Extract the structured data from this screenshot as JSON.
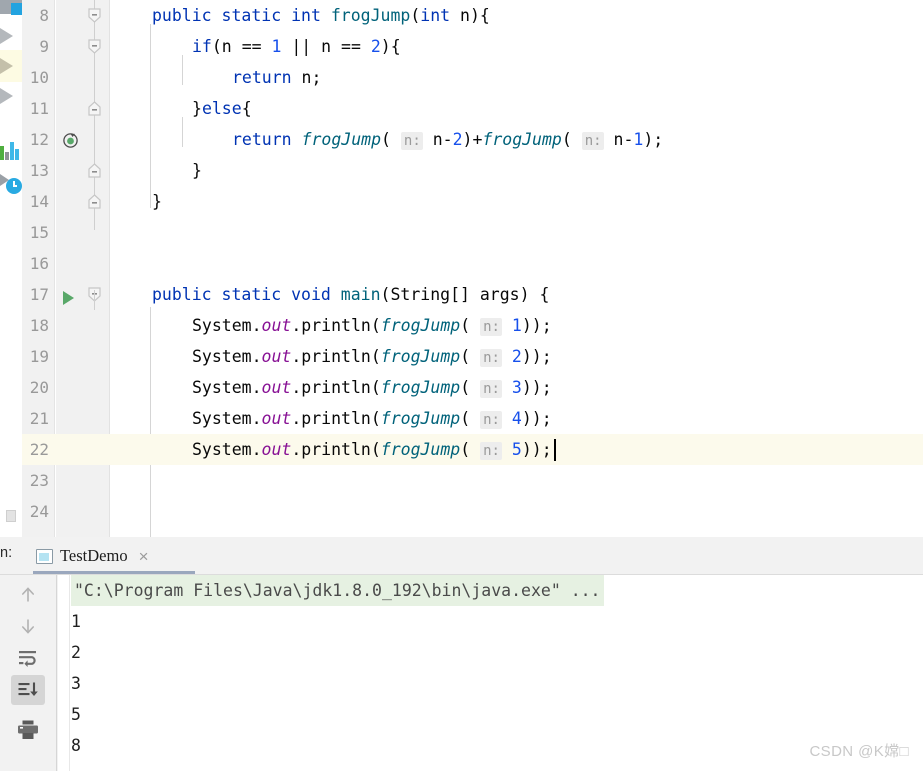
{
  "editor": {
    "font_size_px": 16.5,
    "current_line": 22,
    "first_visible_line": 8,
    "lines": [
      {
        "num": "8",
        "indent": 4,
        "tokens": [
          {
            "t": "public ",
            "c": "kw"
          },
          {
            "t": "static ",
            "c": "kw"
          },
          {
            "t": "int ",
            "c": "kw"
          },
          {
            "t": "frogJump",
            "c": "mth"
          },
          {
            "t": "(",
            "c": "brc"
          },
          {
            "t": "int",
            "c": "kw"
          },
          {
            "t": " n)",
            "c": "pln"
          },
          {
            "t": "{",
            "c": "brc"
          }
        ]
      },
      {
        "num": "9",
        "indent": 8,
        "tokens": [
          {
            "t": "if",
            "c": "kw"
          },
          {
            "t": "(n ",
            "c": "pln"
          },
          {
            "t": "== ",
            "c": "pln"
          },
          {
            "t": "1",
            "c": "num"
          },
          {
            "t": " || n ",
            "c": "pln"
          },
          {
            "t": "== ",
            "c": "pln"
          },
          {
            "t": "2",
            "c": "num"
          },
          {
            "t": "){",
            "c": "brc"
          }
        ]
      },
      {
        "num": "10",
        "indent": 12,
        "tokens": [
          {
            "t": "return ",
            "c": "kw"
          },
          {
            "t": "n;",
            "c": "pln"
          }
        ]
      },
      {
        "num": "11",
        "indent": 8,
        "tokens": [
          {
            "t": "}",
            "c": "brc"
          },
          {
            "t": "else",
            "c": "kw"
          },
          {
            "t": "{",
            "c": "brc"
          }
        ]
      },
      {
        "num": "12",
        "indent": 12,
        "tokens": [
          {
            "t": "return ",
            "c": "kw"
          },
          {
            "t": "frogJump",
            "c": "mthi"
          },
          {
            "t": "( ",
            "c": "brc"
          },
          {
            "t": "n:",
            "c": "hint"
          },
          {
            "t": " n-",
            "c": "pln"
          },
          {
            "t": "2",
            "c": "num"
          },
          {
            "t": ")+",
            "c": "pln"
          },
          {
            "t": "frogJump",
            "c": "mthi"
          },
          {
            "t": "( ",
            "c": "brc"
          },
          {
            "t": "n:",
            "c": "hint"
          },
          {
            "t": " n-",
            "c": "pln"
          },
          {
            "t": "1",
            "c": "num"
          },
          {
            "t": ");",
            "c": "pln"
          }
        ]
      },
      {
        "num": "13",
        "indent": 8,
        "tokens": [
          {
            "t": "}",
            "c": "brc"
          }
        ]
      },
      {
        "num": "14",
        "indent": 4,
        "tokens": [
          {
            "t": "}",
            "c": "brc"
          }
        ]
      },
      {
        "num": "15",
        "indent": 0,
        "tokens": []
      },
      {
        "num": "16",
        "indent": 0,
        "tokens": []
      },
      {
        "num": "17",
        "indent": 4,
        "tokens": [
          {
            "t": "public ",
            "c": "kw"
          },
          {
            "t": "static ",
            "c": "kw"
          },
          {
            "t": "void ",
            "c": "kw"
          },
          {
            "t": "main",
            "c": "mth"
          },
          {
            "t": "(",
            "c": "brc"
          },
          {
            "t": "String",
            "c": "pln"
          },
          {
            "t": "[] args) ",
            "c": "pln"
          },
          {
            "t": "{",
            "c": "brc"
          }
        ]
      },
      {
        "num": "18",
        "indent": 8,
        "tokens": [
          {
            "t": "System.",
            "c": "pln"
          },
          {
            "t": "out",
            "c": "fld"
          },
          {
            "t": ".println(",
            "c": "pln"
          },
          {
            "t": "frogJump",
            "c": "mthi"
          },
          {
            "t": "( ",
            "c": "brc"
          },
          {
            "t": "n:",
            "c": "hint"
          },
          {
            "t": " ",
            "c": "pln"
          },
          {
            "t": "1",
            "c": "num"
          },
          {
            "t": "));",
            "c": "pln"
          }
        ]
      },
      {
        "num": "19",
        "indent": 8,
        "tokens": [
          {
            "t": "System.",
            "c": "pln"
          },
          {
            "t": "out",
            "c": "fld"
          },
          {
            "t": ".println(",
            "c": "pln"
          },
          {
            "t": "frogJump",
            "c": "mthi"
          },
          {
            "t": "( ",
            "c": "brc"
          },
          {
            "t": "n:",
            "c": "hint"
          },
          {
            "t": " ",
            "c": "pln"
          },
          {
            "t": "2",
            "c": "num"
          },
          {
            "t": "));",
            "c": "pln"
          }
        ]
      },
      {
        "num": "20",
        "indent": 8,
        "tokens": [
          {
            "t": "System.",
            "c": "pln"
          },
          {
            "t": "out",
            "c": "fld"
          },
          {
            "t": ".println(",
            "c": "pln"
          },
          {
            "t": "frogJump",
            "c": "mthi"
          },
          {
            "t": "( ",
            "c": "brc"
          },
          {
            "t": "n:",
            "c": "hint"
          },
          {
            "t": " ",
            "c": "pln"
          },
          {
            "t": "3",
            "c": "num"
          },
          {
            "t": "));",
            "c": "pln"
          }
        ]
      },
      {
        "num": "21",
        "indent": 8,
        "tokens": [
          {
            "t": "System.",
            "c": "pln"
          },
          {
            "t": "out",
            "c": "fld"
          },
          {
            "t": ".println(",
            "c": "pln"
          },
          {
            "t": "frogJump",
            "c": "mthi"
          },
          {
            "t": "( ",
            "c": "brc"
          },
          {
            "t": "n:",
            "c": "hint"
          },
          {
            "t": " ",
            "c": "pln"
          },
          {
            "t": "4",
            "c": "num"
          },
          {
            "t": "));",
            "c": "pln"
          }
        ]
      },
      {
        "num": "22",
        "indent": 8,
        "current": true,
        "caret": true,
        "tokens": [
          {
            "t": "System.",
            "c": "pln"
          },
          {
            "t": "out",
            "c": "fld"
          },
          {
            "t": ".println(",
            "c": "pln"
          },
          {
            "t": "frogJump",
            "c": "mthi"
          },
          {
            "t": "( ",
            "c": "brc"
          },
          {
            "t": "n:",
            "c": "hint"
          },
          {
            "t": " ",
            "c": "pln"
          },
          {
            "t": "5",
            "c": "num"
          },
          {
            "t": "));",
            "c": "pln"
          }
        ]
      },
      {
        "num": "23",
        "indent": 0,
        "tokens": []
      },
      {
        "num": "24",
        "indent": 0,
        "tokens": []
      }
    ],
    "gutter_icons": [
      {
        "line": "12",
        "kind": "recursive-method-icon"
      },
      {
        "line": "17",
        "kind": "run-method-icon"
      }
    ],
    "fold_markers": [
      "8",
      "9",
      "11",
      "13",
      "14",
      "17"
    ]
  },
  "run_panel": {
    "label": "n:",
    "tab": {
      "title": "TestDemo",
      "icon": "run-configuration-icon",
      "close": "×"
    },
    "toolbar": [
      {
        "name": "up-arrow-icon",
        "selected": false
      },
      {
        "name": "down-arrow-icon",
        "selected": false
      },
      {
        "name": "soft-wrap-icon",
        "selected": false
      },
      {
        "name": "scroll-to-end-icon",
        "selected": true
      },
      {
        "name": "print-icon",
        "selected": false
      }
    ],
    "console": {
      "command": "\"C:\\Program Files\\Java\\jdk1.8.0_192\\bin\\java.exe\" ...",
      "output": [
        "1",
        "2",
        "3",
        "5",
        "8"
      ]
    }
  },
  "tool_strip": {
    "icons": [
      "run-icon",
      "debug-icon",
      "stop-icon",
      "profiler-chart-icon",
      "run-with-coverage-clock-icon"
    ]
  },
  "watermark": {
    "text": "CSDN @K嫦□"
  },
  "colors": {
    "keyword": "#0033b3",
    "method": "#00627a",
    "number": "#1750eb",
    "static_field": "#871094",
    "plain": "#080808",
    "hint_bg": "#ededed",
    "hint_fg": "#9a9a9a",
    "gutter_bg": "#f1f1f1",
    "line_number": "#999999",
    "current_line_bg": "#fcfaec",
    "console_cmd_bg": "#e6f1e2",
    "panel_bg": "#f2f2f2",
    "run_green": "#59a869",
    "tab_underline": "#9aa7bd"
  }
}
